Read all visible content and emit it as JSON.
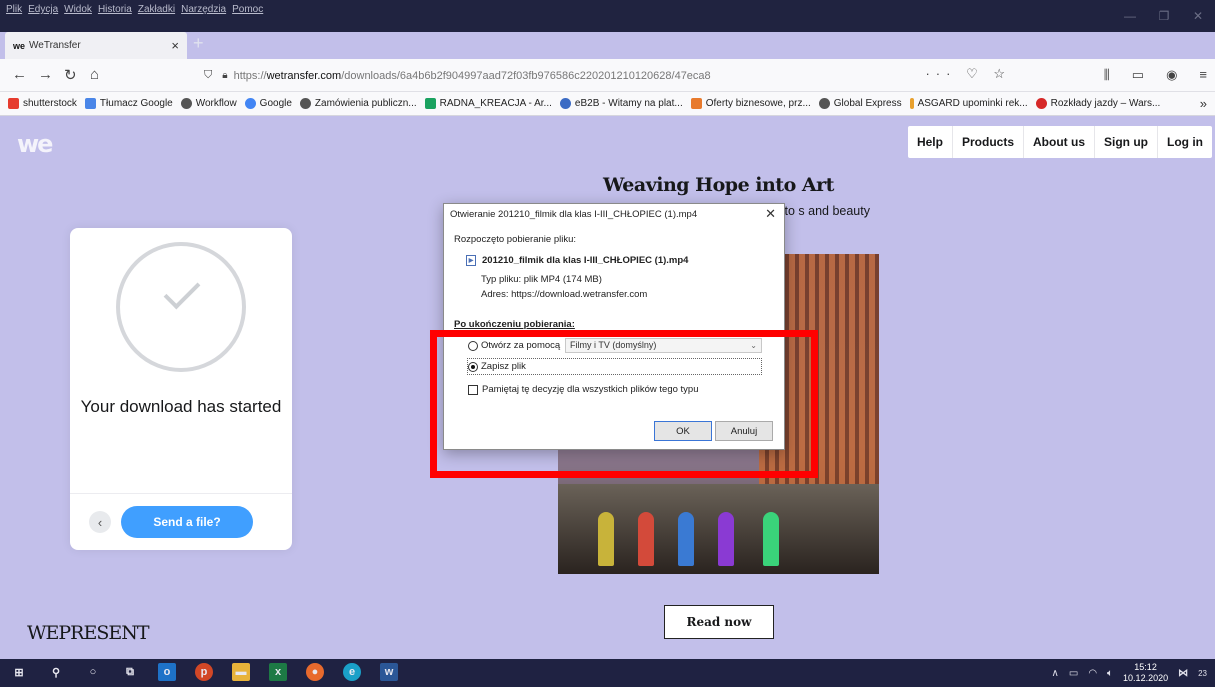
{
  "browser": {
    "menu_items": [
      "Plik",
      "Edycja",
      "Widok",
      "Historia",
      "Zakładki",
      "Narzędzia",
      "Pomoc"
    ],
    "tab_title": "WeTransfer",
    "tab_favicon": "we",
    "url_prefix": "https://",
    "url_host": "wetransfer.com",
    "url_path": "/downloads/6a4b6b2f904997aad72f03fb976586c220201210120628/47eca8",
    "url_actions": "··· ♡ ☆",
    "bookmarks": [
      {
        "label": "shutterstock",
        "color": "#e63b2e"
      },
      {
        "label": "Tłumacz Google",
        "color": "#4a86e8"
      },
      {
        "label": "Workflow",
        "color": "#555555"
      },
      {
        "label": "Google",
        "color": "#4285f4"
      },
      {
        "label": "Zamówienia publiczn...",
        "color": "#555555"
      },
      {
        "label": "RADNA_KREACJA - Ar...",
        "color": "#1aa260"
      },
      {
        "label": "eB2B - Witamy na plat...",
        "color": "#3b6bc4"
      },
      {
        "label": "Oferty biznesowe, prz...",
        "color": "#e87a2d"
      },
      {
        "label": "Global Express",
        "color": "#555555"
      },
      {
        "label": "ASGARD upominki rek...",
        "color": "#e8a02d"
      },
      {
        "label": "Rozkłady jazdy – Wars...",
        "color": "#d62828"
      }
    ],
    "bookmarks_more": "»"
  },
  "page": {
    "logo": "we",
    "nav": [
      "Help",
      "Products",
      "About us",
      "Sign up",
      "Log in"
    ],
    "card": {
      "title": "Your download has started",
      "send_button": "Send a file?",
      "back_glyph": "‹"
    },
    "ad": {
      "title": "Weaving Hope into Art",
      "subtitle": "otographs to s and beauty",
      "read_button": "Read now"
    },
    "footer_brand": "WEPRESENT"
  },
  "dialog": {
    "title": "Otwieranie 201210_filmik dla klas I-III_CHŁOPIEC (1).mp4",
    "started": "Rozpoczęto pobieranie pliku:",
    "filename": "201210_filmik dla klas I-III_CHŁOPIEC (1).mp4",
    "type": "Typ pliku: plik MP4 (174 MB)",
    "address": "Adres: https://download.wetransfer.com",
    "after_label": "Po ukończeniu pobierania:",
    "open_with": "Otwórz za pomocą",
    "open_with_app": "Filmy i TV (domyślny)",
    "save_file": "Zapisz plik",
    "remember": "Pamiętaj tę decyzję dla wszystkich plików tego typu",
    "ok": "OK",
    "cancel": "Anuluj",
    "selected_option": "save_file"
  },
  "taskbar": {
    "time": "15:12",
    "date": "10.12.2020",
    "notifications": "23"
  },
  "colors": {
    "page_bg": "#c2bfea",
    "send_button": "#409fff",
    "highlight": "#ff0000",
    "titlebar": "#202340"
  }
}
